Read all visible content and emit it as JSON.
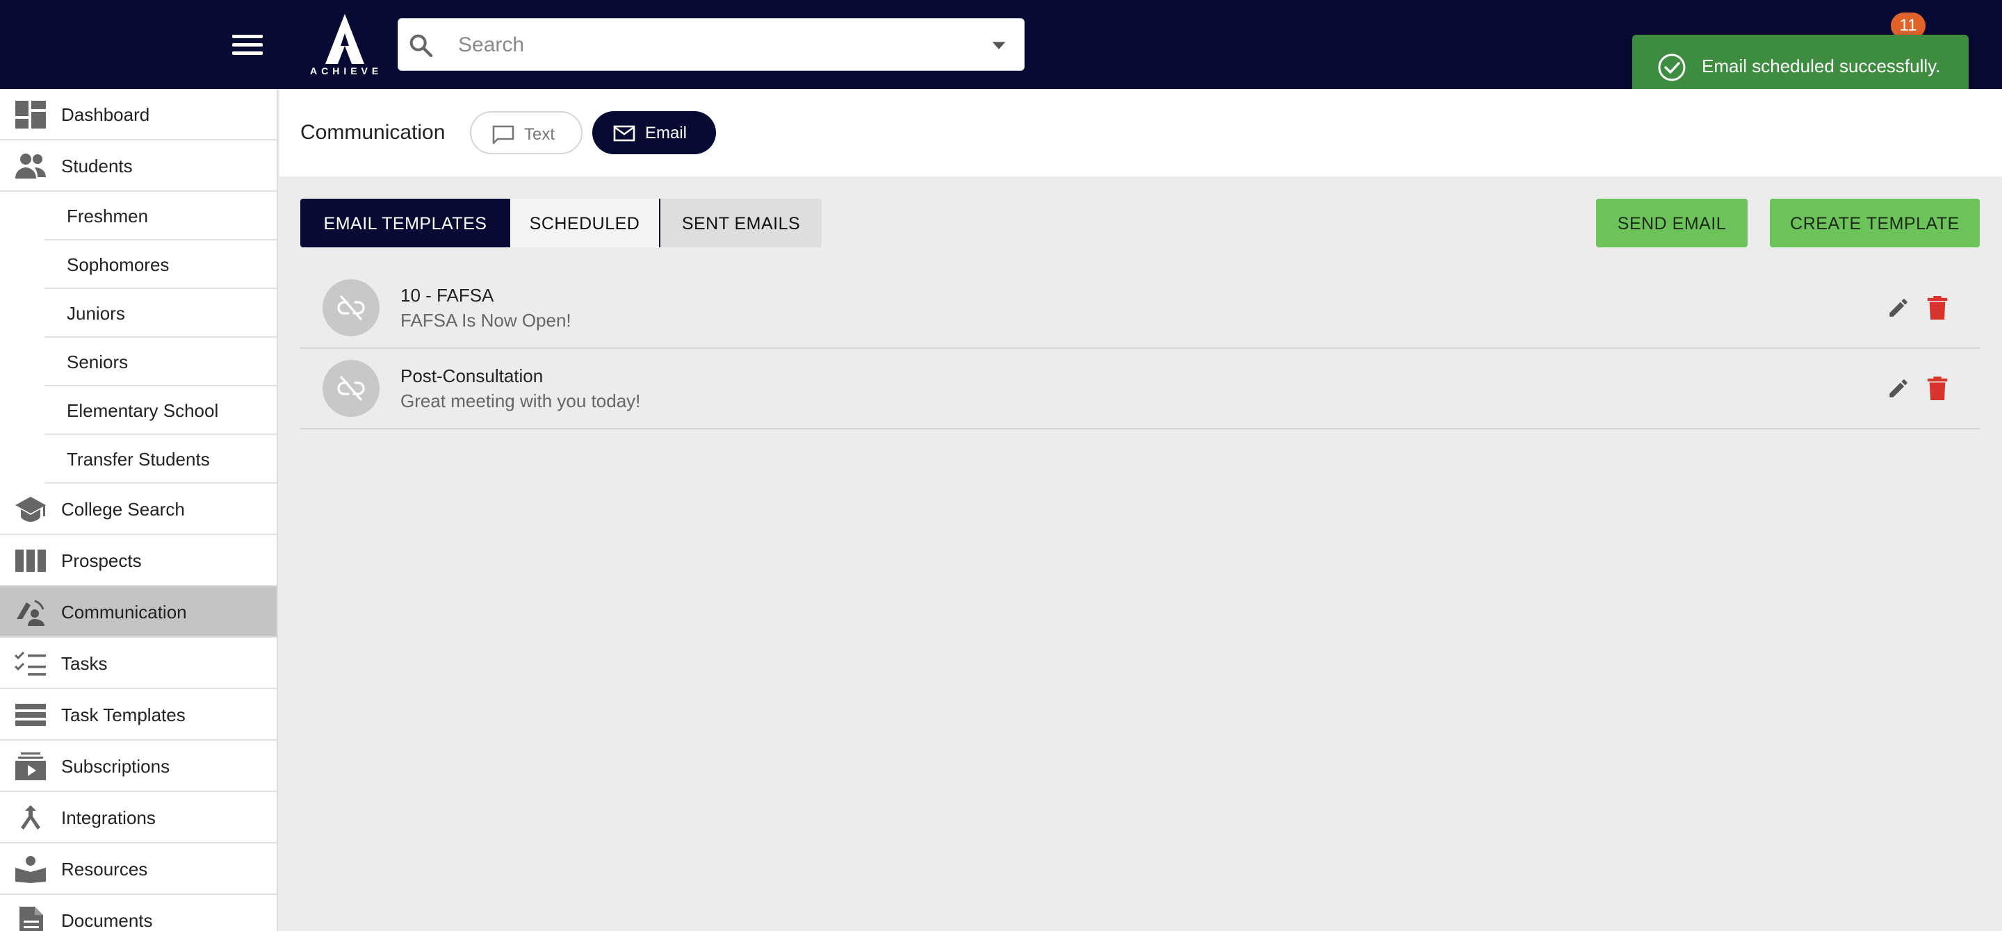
{
  "topbar": {
    "logo_text": "ACHIEVE",
    "search": {
      "placeholder": "Search",
      "value": ""
    },
    "notification_count": "11"
  },
  "toast": {
    "message": "Email scheduled successfully.",
    "color": "#3d8c3f"
  },
  "sidebar": {
    "items": [
      {
        "label": "Dashboard",
        "icon": "dashboard-icon"
      },
      {
        "label": "Students",
        "icon": "people-icon"
      },
      {
        "label": "College Search",
        "icon": "graduation-cap-icon"
      },
      {
        "label": "Prospects",
        "icon": "columns-icon"
      },
      {
        "label": "Communication",
        "icon": "communication-icon",
        "active": true
      },
      {
        "label": "Tasks",
        "icon": "checklist-icon"
      },
      {
        "label": "Task Templates",
        "icon": "list-icon"
      },
      {
        "label": "Subscriptions",
        "icon": "subscriptions-icon"
      },
      {
        "label": "Integrations",
        "icon": "merge-icon"
      },
      {
        "label": "Resources",
        "icon": "book-icon"
      },
      {
        "label": "Documents",
        "icon": "document-icon"
      }
    ],
    "student_subitems": [
      "Freshmen",
      "Sophomores",
      "Juniors",
      "Seniors",
      "Elementary School",
      "Transfer Students"
    ]
  },
  "header": {
    "title": "Communication",
    "chips": {
      "text": "Text",
      "email": "Email"
    }
  },
  "tabs": {
    "templates": "EMAIL TEMPLATES",
    "scheduled": "SCHEDULED",
    "sent": "SENT EMAILS"
  },
  "actions": {
    "send_email": "SEND EMAIL",
    "create_template": "CREATE TEMPLATE"
  },
  "templates": [
    {
      "name": "10 - FAFSA",
      "subject": "FAFSA Is Now Open!"
    },
    {
      "name": "Post-Consultation",
      "subject": "Great meeting with you today!"
    }
  ],
  "colors": {
    "navy": "#070b33",
    "green_button": "#6cc35a",
    "delete_red": "#d9342b",
    "badge_orange": "#e0642a"
  }
}
